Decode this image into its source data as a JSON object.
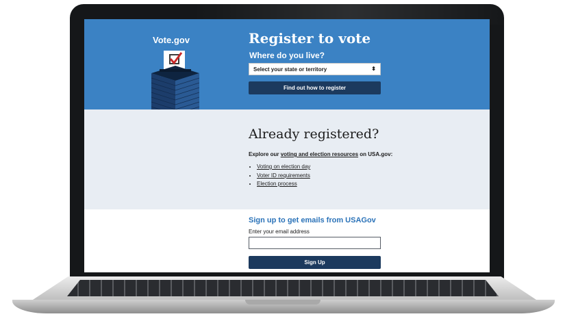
{
  "site": {
    "brand": "Vote.gov"
  },
  "hero": {
    "title": "Register to vote",
    "question": "Where do you live?",
    "state_select_value": "Select your state or territory",
    "find_button": "Find out how to register",
    "illustration_icon": "ballot-box-icon"
  },
  "registered": {
    "title": "Already registered?",
    "explore_prefix": "Explore our ",
    "explore_link": "voting and election resources",
    "explore_suffix": " on USA.gov:",
    "links": [
      "Voting on election day",
      "Voter ID requirements",
      "Election process"
    ]
  },
  "signup": {
    "title": "Sign up to get emails from USAGov",
    "email_label": "Enter your email address",
    "email_value": "",
    "button": "Sign Up"
  },
  "colors": {
    "hero_blue": "#3b82c4",
    "button_navy": "#1c3a5e",
    "section_gray": "#e8edf3",
    "signup_blue": "#2a72b8",
    "check_red": "#c92a2a"
  }
}
